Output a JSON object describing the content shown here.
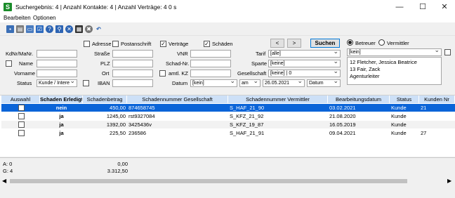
{
  "window": {
    "title": "Suchergebnis: 4 | Anzahl Kontakte: 4 | Anzahl Verträge: 4   0 s",
    "app_icon": "S"
  },
  "menu": {
    "items": [
      "Bearbeiten",
      "Optionen"
    ]
  },
  "toolbar": {
    "icons": [
      "save-icon",
      "print-icon",
      "form-icon",
      "check-list-icon",
      "help-icon",
      "search-icon",
      "close-icon",
      "delete-icon",
      "cancel-icon",
      "undo-icon"
    ]
  },
  "filters": {
    "adresse": "Adresse",
    "postanschrift": "Postanschrift",
    "vertraege": "Verträge",
    "schaeden": "Schäden",
    "kdnr_label": "KdNr/MaNr.",
    "name_label": "Name",
    "vorname_label": "Vorname",
    "status_label": "Status",
    "status_value": "Kunde / Intere",
    "strasse_label": "Straße",
    "plz_label": "PLZ",
    "ort_label": "Ort",
    "iban_label": "IBAN",
    "vnr_label": "VNR",
    "schadnr_label": "Schad-Nr.",
    "amtl_kz_label": "amtl. KZ",
    "tarif_label": "Tarif",
    "tarif_value": "[alle]",
    "sparte_label": "Sparte",
    "sparte_value": "[keine]",
    "gesellschaft_label": "Gesellschaft",
    "gesellschaft_value": "[keine]  |  0",
    "datum_label": "Datum",
    "datum_value": "[kein]",
    "am_value": "am",
    "date_value": "26.05.2021",
    "datum2_value": "Datum"
  },
  "actions": {
    "prev": "<",
    "next": ">",
    "search": "Suchen"
  },
  "betreuer": {
    "option1": "Betreuer",
    "option2": "Vermittler",
    "select_value": "[kein]",
    "list": [
      "12  Fletcher, Jessica Beatrice",
      "13  Fair, Zack",
      "Agenturleiter"
    ]
  },
  "table": {
    "headers": [
      "Auswahl",
      "Schaden Erledigt",
      "Schadenbetrag",
      "Schadennummer Gesellschaft",
      "Schadennummer Vermittler",
      "Bearbeitungsdatum",
      "Status",
      "Kunden Nr"
    ],
    "rows": [
      {
        "erledigt": "nein",
        "betrag": "450,00",
        "nr_ges": "874658745",
        "nr_verm": "S_HAF_21_90",
        "datum": "03.02.2021",
        "status": "Kunde",
        "kunde": "21"
      },
      {
        "erledigt": "ja",
        "betrag": "1245,00",
        "nr_ges": "rst9327084",
        "nr_verm": "S_KFZ_21_92",
        "datum": "21.08.2020",
        "status": "Kunde",
        "kunde": ""
      },
      {
        "erledigt": "ja",
        "betrag": "1392,00",
        "nr_ges": "3425436v",
        "nr_verm": "S_KFZ_19_87",
        "datum": "16.05.2019",
        "status": "Kunde",
        "kunde": ""
      },
      {
        "erledigt": "ja",
        "betrag": "225,50",
        "nr_ges": "236586",
        "nr_verm": "S_HAF_21_91",
        "datum": "09.04.2021",
        "status": "Kunde",
        "kunde": "27"
      }
    ]
  },
  "totals": {
    "a_label": "A: 0",
    "a_value": "0,00",
    "g_label": "G: 4",
    "g_value": "3.312,50"
  }
}
